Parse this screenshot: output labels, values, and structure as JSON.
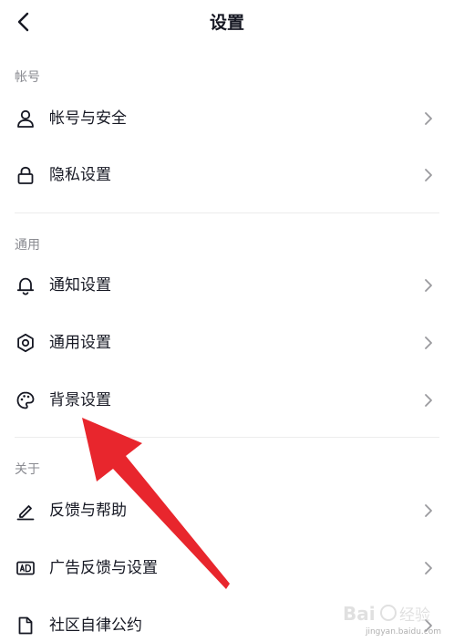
{
  "header": {
    "title": "设置"
  },
  "sections": [
    {
      "label": "帐号",
      "items": [
        {
          "label": "帐号与安全",
          "icon": "person-icon"
        },
        {
          "label": "隐私设置",
          "icon": "lock-icon"
        }
      ]
    },
    {
      "label": "通用",
      "items": [
        {
          "label": "通知设置",
          "icon": "bell-icon"
        },
        {
          "label": "通用设置",
          "icon": "gear-icon"
        },
        {
          "label": "背景设置",
          "icon": "palette-icon"
        }
      ]
    },
    {
      "label": "关于",
      "items": [
        {
          "label": "反馈与帮助",
          "icon": "pencil-icon"
        },
        {
          "label": "广告反馈与设置",
          "icon": "ad-icon"
        },
        {
          "label": "社区自律公约",
          "icon": "document-icon"
        }
      ]
    }
  ],
  "overlay": {
    "arrow_color": "#e8262d"
  },
  "watermark": {
    "text": "jingyan.baidu.com"
  }
}
